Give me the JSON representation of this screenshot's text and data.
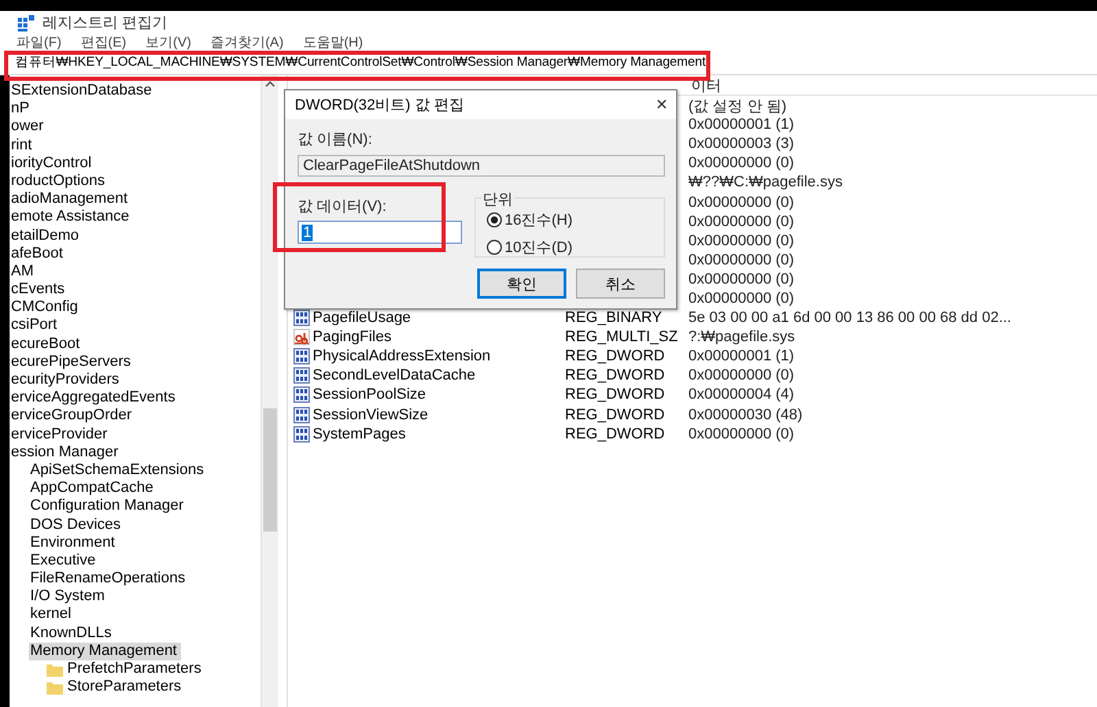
{
  "window": {
    "title": "레지스트리 편집기"
  },
  "menu": [
    "파일(F)",
    "편집(E)",
    "보기(V)",
    "즐겨찾기(A)",
    "도움말(H)"
  ],
  "address": "컴퓨터₩HKEY_LOCAL_MACHINE₩SYSTEM₩CurrentControlSet₩Control₩Session Manager₩Memory Management",
  "tree": [
    {
      "label": "SExtensionDatabase",
      "selected": false
    },
    {
      "label": "nP",
      "selected": false
    },
    {
      "label": "ower",
      "selected": false
    },
    {
      "label": "rint",
      "selected": false
    },
    {
      "label": "iorityControl",
      "selected": false
    },
    {
      "label": "roductOptions",
      "selected": false
    },
    {
      "label": "adioManagement",
      "selected": false
    },
    {
      "label": "emote Assistance",
      "selected": false
    },
    {
      "label": "etailDemo",
      "selected": false
    },
    {
      "label": "afeBoot",
      "selected": false
    },
    {
      "label": "AM",
      "selected": false
    },
    {
      "label": "cEvents",
      "selected": false
    },
    {
      "label": "CMConfig",
      "selected": false
    },
    {
      "label": "csiPort",
      "selected": false
    },
    {
      "label": "ecureBoot",
      "selected": false
    },
    {
      "label": "ecurePipeServers",
      "selected": false
    },
    {
      "label": "ecurityProviders",
      "selected": false
    },
    {
      "label": "erviceAggregatedEvents",
      "selected": false
    },
    {
      "label": "erviceGroupOrder",
      "selected": false
    },
    {
      "label": "erviceProvider",
      "selected": false
    },
    {
      "label": "ession Manager",
      "selected": false,
      "children": [
        {
          "label": "ApiSetSchemaExtensions",
          "selected": false
        },
        {
          "label": "AppCompatCache",
          "selected": false
        },
        {
          "label": "Configuration Manager",
          "selected": false
        },
        {
          "label": "DOS Devices",
          "selected": false
        },
        {
          "label": "Environment",
          "selected": false
        },
        {
          "label": "Executive",
          "selected": false
        },
        {
          "label": "FileRenameOperations",
          "selected": false
        },
        {
          "label": "I/O System",
          "selected": false
        },
        {
          "label": "kernel",
          "selected": false
        },
        {
          "label": "KnownDLLs",
          "selected": false
        },
        {
          "label": "Memory Management",
          "selected": true,
          "children": [
            {
              "label": "PrefetchParameters",
              "selected": false
            },
            {
              "label": "StoreParameters",
              "selected": false
            }
          ]
        }
      ]
    }
  ],
  "values": {
    "column_3": "이터",
    "rows": [
      {
        "data": "(값 설정 안 됨)"
      },
      {
        "data": "0x00000001 (1)"
      },
      {
        "data": "0x00000003 (3)"
      },
      {
        "data": "0x00000000 (0)"
      },
      {
        "data": "₩??₩C:₩pagefile.sys"
      },
      {
        "data": "0x00000000 (0)"
      },
      {
        "data": "0x00000000 (0)"
      },
      {
        "data": "0x00000000 (0)"
      },
      {
        "data": "0x00000000 (0)"
      },
      {
        "data": "0x00000000 (0)"
      },
      {
        "data": "0x00000000 (0)"
      },
      {
        "name": "PagefileUsage",
        "type": "REG_BINARY",
        "data": "5e 03 00 00 a1 6d 00 00 13 86 00 00 68 dd 02...",
        "kind": "binary"
      },
      {
        "name": "PagingFiles",
        "type": "REG_MULTI_SZ",
        "data": "?:₩pagefile.sys",
        "kind": "string"
      },
      {
        "name": "PhysicalAddressExtension",
        "type": "REG_DWORD",
        "data": "0x00000001 (1)",
        "kind": "binary"
      },
      {
        "name": "SecondLevelDataCache",
        "type": "REG_DWORD",
        "data": "0x00000000 (0)",
        "kind": "binary"
      },
      {
        "name": "SessionPoolSize",
        "type": "REG_DWORD",
        "data": "0x00000004 (4)",
        "kind": "binary"
      },
      {
        "name": "SessionViewSize",
        "type": "REG_DWORD",
        "data": "0x00000030 (48)",
        "kind": "binary"
      },
      {
        "name": "SystemPages",
        "type": "REG_DWORD",
        "data": "0x00000000 (0)",
        "kind": "binary"
      }
    ]
  },
  "dialog": {
    "title": "DWORD(32비트) 값 편집",
    "close": "✕",
    "name_label": "값 이름(N):",
    "name_value": "ClearPageFileAtShutdown",
    "data_label": "값 데이터(V):",
    "data_value": "1",
    "base_label": "단위",
    "bases": [
      {
        "label": "16진수(H)",
        "selected": true
      },
      {
        "label": "10진수(D)",
        "selected": false
      }
    ],
    "buttons": [
      {
        "label": "확인",
        "kind": "default"
      },
      {
        "label": "취소",
        "kind": "normal"
      }
    ]
  },
  "annotations": [
    {
      "color": "#e5212c"
    },
    {
      "color": "#e5212c"
    }
  ]
}
